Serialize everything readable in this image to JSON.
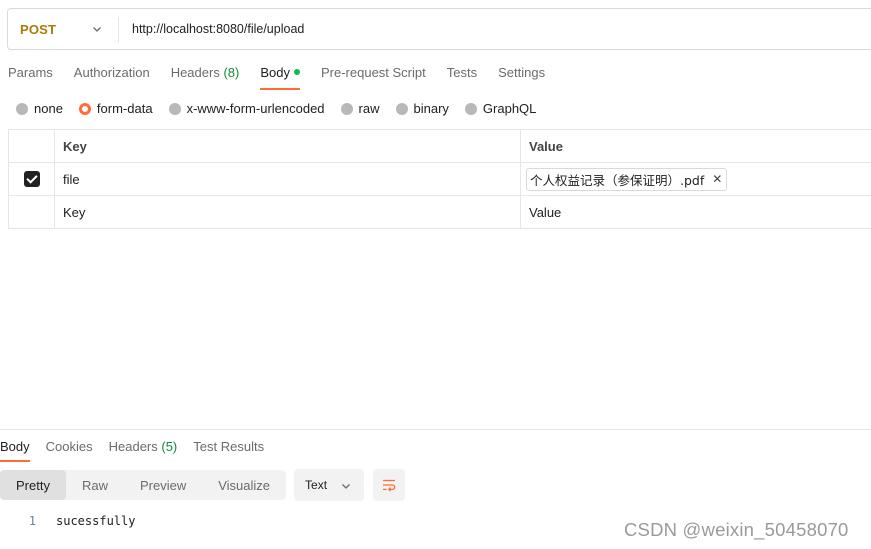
{
  "request": {
    "method": "POST",
    "url": "http://localhost:8080/file/upload"
  },
  "request_tabs": [
    {
      "label": "Params"
    },
    {
      "label": "Authorization"
    },
    {
      "label": "Headers",
      "count": "(8)"
    },
    {
      "label": "Body",
      "active": true
    },
    {
      "label": "Pre-request Script"
    },
    {
      "label": "Tests"
    },
    {
      "label": "Settings"
    }
  ],
  "body_types": [
    "none",
    "form-data",
    "x-www-form-urlencoded",
    "raw",
    "binary",
    "GraphQL"
  ],
  "body_selected": "form-data",
  "table": {
    "headers": {
      "key": "Key",
      "value": "Value"
    },
    "rows": [
      {
        "checked": true,
        "key": "file",
        "value": "个人权益记录（参保证明）.pdf"
      }
    ],
    "placeholder": {
      "key": "Key",
      "value": "Value"
    }
  },
  "response_tabs": [
    {
      "label": "Body",
      "active": true
    },
    {
      "label": "Cookies"
    },
    {
      "label": "Headers",
      "count": "(5)"
    },
    {
      "label": "Test Results"
    }
  ],
  "view_modes": [
    "Pretty",
    "Raw",
    "Preview",
    "Visualize"
  ],
  "view_selected": "Pretty",
  "format_select": "Text",
  "response_body": [
    {
      "line": "1",
      "text": "sucessfully"
    }
  ],
  "watermark": "CSDN @weixin_50458070",
  "colors": {
    "accent": "#ff6c37",
    "method": "#ad7a03",
    "count": "#0f8a3a",
    "dot": "#0cbb52"
  },
  "icons": [
    "chevron-down-icon",
    "checkbox-checked-icon",
    "close-icon",
    "wrap-lines-icon"
  ]
}
